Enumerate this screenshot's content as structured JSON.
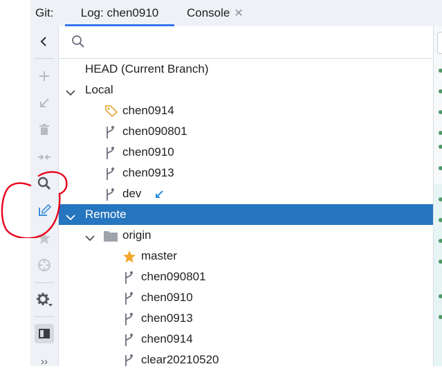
{
  "tabs": {
    "prefix": "Git:",
    "log_label": "Log: chen0910",
    "console_label": "Console",
    "close_glyph": "✕"
  },
  "search": {
    "placeholder": ""
  },
  "toolbar": {
    "icons": [
      "collapse-chevron-left-icon",
      "add-plus-icon",
      "checkout-arrow-icon",
      "delete-trash-icon",
      "merge-compare-icon",
      "search-magnifier-icon",
      "update-branch-icon",
      "favorite-star-icon",
      "track-target-icon",
      "settings-gear-icon",
      "panel-layout-icon",
      "more-chevron-icon"
    ],
    "more_label": "››",
    "annotated_icon": "update-branch-icon",
    "annotation_color": "#e8001c"
  },
  "tree": {
    "head_label": "HEAD (Current Branch)",
    "local": {
      "label": "Local",
      "items": [
        {
          "label": "chen0914",
          "icon": "tag-icon"
        },
        {
          "label": "chen090801",
          "icon": "branch-icon"
        },
        {
          "label": "chen0910",
          "icon": "branch-icon"
        },
        {
          "label": "chen0913",
          "icon": "branch-icon"
        },
        {
          "label": "dev",
          "icon": "branch-icon",
          "status_icon": "incoming-arrow-icon"
        }
      ]
    },
    "remote": {
      "label": "Remote",
      "selected": true,
      "origin": {
        "label": "origin",
        "items": [
          {
            "label": "master",
            "icon": "star-icon"
          },
          {
            "label": "chen090801",
            "icon": "branch-icon"
          },
          {
            "label": "chen0910",
            "icon": "branch-icon"
          },
          {
            "label": "chen0913",
            "icon": "branch-icon"
          },
          {
            "label": "chen0914",
            "icon": "branch-icon"
          },
          {
            "label": "clear20210520",
            "icon": "branch-icon"
          }
        ]
      }
    }
  },
  "colors": {
    "selection": "#2675bf",
    "tab_underline": "#3574f0",
    "tag": "#e2a52d",
    "star": "#f2a82b",
    "incoming_arrow": "#2d8fe0",
    "commit_dot": "#4f9a68"
  }
}
